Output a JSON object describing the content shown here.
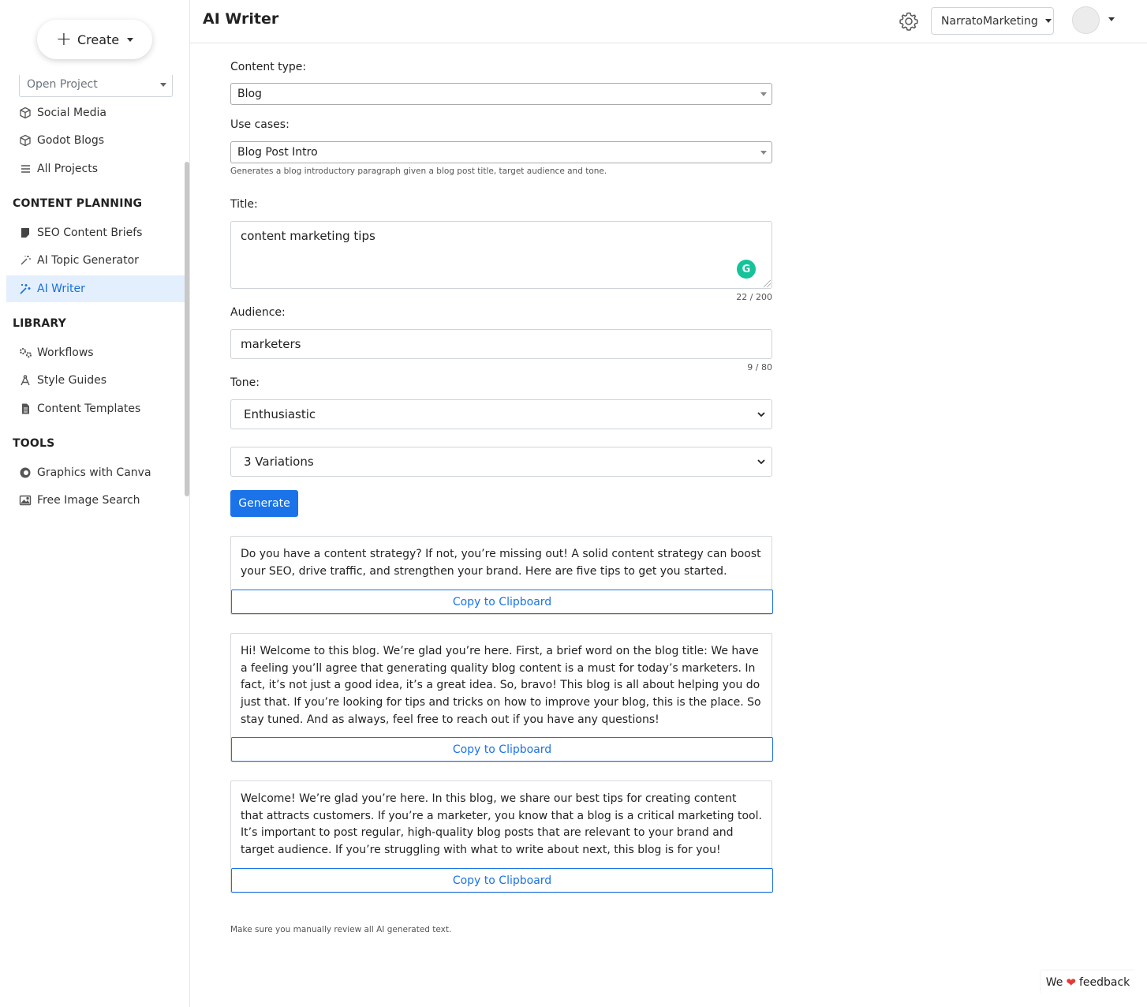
{
  "sidebar": {
    "create_label": "Create",
    "open_project_placeholder": "Open Project",
    "projects": [
      {
        "label": "Social Media",
        "icon": "cube-icon"
      },
      {
        "label": "Godot Blogs",
        "icon": "cube-icon"
      },
      {
        "label": "All Projects",
        "icon": "list-icon"
      }
    ],
    "sections": {
      "content_planning": "CONTENT PLANNING",
      "library": "LIBRARY",
      "tools": "TOOLS"
    },
    "content_planning_items": [
      {
        "label": "SEO Content Briefs",
        "icon": "note-icon"
      },
      {
        "label": "AI Topic Generator",
        "icon": "magic-wand-icon"
      },
      {
        "label": "AI Writer",
        "icon": "magic-wand-pen-icon",
        "active": true
      }
    ],
    "library_items": [
      {
        "label": "Workflows",
        "icon": "gears-icon"
      },
      {
        "label": "Style Guides",
        "icon": "compass-icon"
      },
      {
        "label": "Content Templates",
        "icon": "document-icon"
      }
    ],
    "tools_items": [
      {
        "label": "Graphics with Canva",
        "icon": "canva-icon"
      },
      {
        "label": "Free Image Search",
        "icon": "image-icon"
      }
    ]
  },
  "header": {
    "title": "AI Writer",
    "account_name": "NarratoMarketing"
  },
  "form": {
    "content_type_label": "Content type:",
    "content_type_value": "Blog",
    "use_cases_label": "Use cases:",
    "use_case_value": "Blog Post Intro",
    "use_case_help": "Generates a blog introductory paragraph given a blog post title, target audience and tone.",
    "title_label": "Title:",
    "title_value": "content marketing tips",
    "title_counter": "22 / 200",
    "audience_label": "Audience:",
    "audience_value": "marketers",
    "audience_counter": "9 / 80",
    "tone_label": "Tone:",
    "tone_value": "Enthusiastic",
    "variations_value": "3 Variations",
    "generate_label": "Generate"
  },
  "results": [
    {
      "text": "Do you have a content strategy? If not, you’re missing out! A solid content strategy can boost your SEO, drive traffic, and strengthen your brand. Here are five tips to get you started.",
      "copy_label": "Copy to Clipboard"
    },
    {
      "text": "Hi! Welcome to this blog. We’re glad you’re here. First, a brief word on the blog title: We have a feeling you’ll agree that generating quality blog content is a must for today’s marketers. In fact, it’s not just a good idea, it’s a great idea. So, bravo! This blog is all about helping you do just that. If you’re looking for tips and tricks on how to improve your blog, this is the place. So stay tuned. And as always, feel free to reach out if you have any questions!",
      "copy_label": "Copy to Clipboard"
    },
    {
      "text": "Welcome! We’re glad you’re here. In this blog, we share our best tips for creating content that attracts customers. If you’re a marketer, you know that a blog is a critical marketing tool. It’s important to post regular, high-quality blog posts that are relevant to your brand and target audience. If you’re struggling with what to write about next, this blog is for you!",
      "copy_label": "Copy to Clipboard"
    }
  ],
  "disclaimer": "Make sure you manually review all AI generated text.",
  "feedback": {
    "prefix": "We",
    "suffix": "feedback"
  },
  "colors": {
    "accent": "#1a73e8",
    "active_bg": "#e3effd",
    "grammarly": "#15c39a",
    "heart": "#e53935"
  }
}
